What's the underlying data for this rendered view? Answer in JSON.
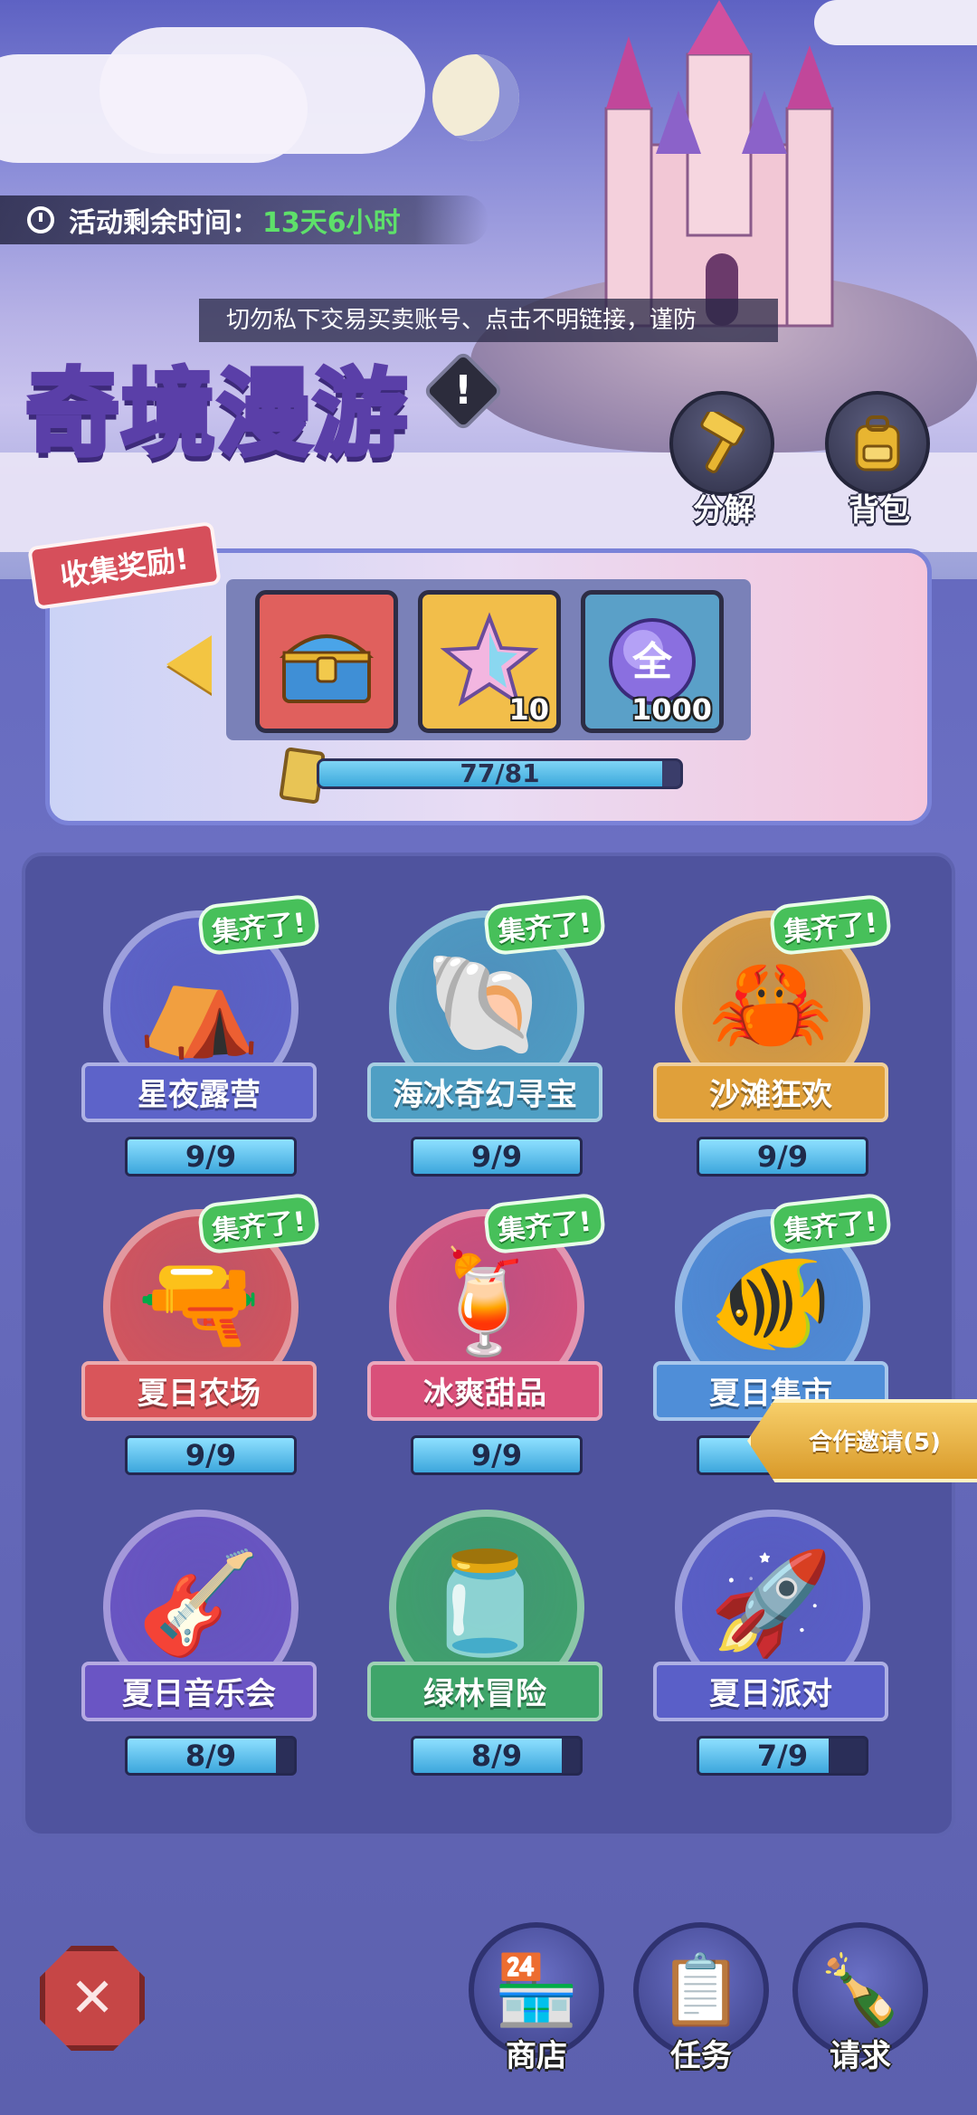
{
  "event": {
    "timer_label": "活动剩余时间：",
    "timer_value": "13天6小时",
    "notice": "切勿私下交易买卖账号、点击不明链接，谨防",
    "title": "奇境漫游",
    "info_symbol": "!"
  },
  "top_actions": [
    {
      "label": "分解",
      "icon": "hammer-icon"
    },
    {
      "label": "背包",
      "icon": "backpack-icon"
    }
  ],
  "rewards": {
    "tag": "收集奖励!",
    "items": [
      {
        "icon": "treasure-chest-icon",
        "qty": ""
      },
      {
        "icon": "star-icon",
        "qty": "10"
      },
      {
        "icon": "full-orb-icon",
        "qty": "1000",
        "symbol": "全"
      }
    ],
    "progress_text": "77/81",
    "progress_fraction": 0.9506
  },
  "collections": [
    {
      "name": "星夜露营",
      "progress": "9/9",
      "fraction": 1.0,
      "done": "集齐了!",
      "color": "#5d63c9",
      "icon": "tent-icon",
      "glyph": "⛺"
    },
    {
      "name": "海冰奇幻寻宝",
      "progress": "9/9",
      "fraction": 1.0,
      "done": "集齐了!",
      "color": "#4f9fc4",
      "icon": "seashell-icon",
      "glyph": "🐚"
    },
    {
      "name": "沙滩狂欢",
      "progress": "9/9",
      "fraction": 1.0,
      "done": "集齐了!",
      "color": "#e0a03a",
      "icon": "sand-bucket-icon",
      "glyph": "🦀"
    },
    {
      "name": "夏日农场",
      "progress": "9/9",
      "fraction": 1.0,
      "done": "集齐了!",
      "color": "#d9555a",
      "icon": "water-gun-icon",
      "glyph": "🔫"
    },
    {
      "name": "冰爽甜品",
      "progress": "9/9",
      "fraction": 1.0,
      "done": "集齐了!",
      "color": "#d9507a",
      "icon": "drinks-icon",
      "glyph": "🍹"
    },
    {
      "name": "夏日集市",
      "progress": "",
      "fraction": 1.0,
      "done": "集齐了!",
      "color": "#4f8ed8",
      "icon": "goldfish-icon",
      "glyph": "🐠"
    },
    {
      "name": "夏日音乐会",
      "progress": "8/9",
      "fraction": 0.889,
      "done": "",
      "color": "#6a55c4",
      "icon": "guitar-icon",
      "glyph": "🎸"
    },
    {
      "name": "绿林冒险",
      "progress": "8/9",
      "fraction": 0.889,
      "done": "",
      "color": "#3fa56a",
      "icon": "firefly-jar-icon",
      "glyph": "🫙"
    },
    {
      "name": "夏日派对",
      "progress": "7/9",
      "fraction": 0.778,
      "done": "",
      "color": "#5a5fc8",
      "icon": "firework-rocket-icon",
      "glyph": "🚀"
    }
  ],
  "coop_invite": "合作邀请(5)",
  "bottom_nav": [
    {
      "label": "商店",
      "icon": "shop-icon",
      "glyph": "🏪"
    },
    {
      "label": "任务",
      "icon": "clipboard-icon",
      "glyph": "📋"
    },
    {
      "label": "请求",
      "icon": "message-bottle-icon",
      "glyph": "🍾"
    }
  ],
  "close_symbol": "✕"
}
